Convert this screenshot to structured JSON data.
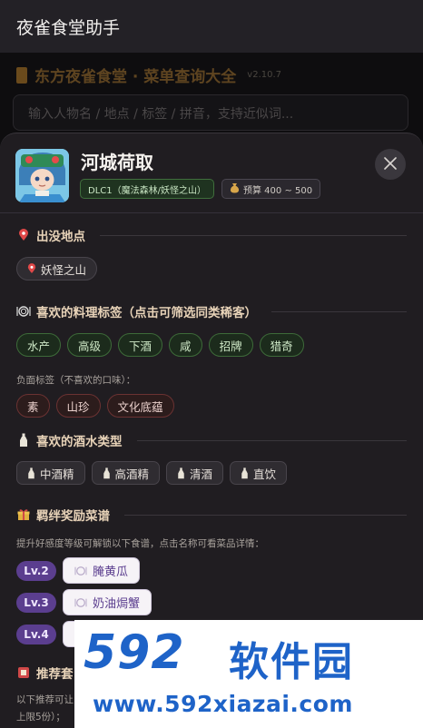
{
  "app": {
    "title": "夜雀食堂助手"
  },
  "behind": {
    "header_title": "东方夜雀食堂 · 菜单查询大全",
    "version": "v2.10.7",
    "search_placeholder": "输入人物名 / 地点 / 标签 / 拼音，支持近似词..."
  },
  "character": {
    "name": "河城荷取",
    "dlc": "DLC1（魔法森林/妖怪之山）",
    "budget": "预算 400 ~ 500"
  },
  "sections": {
    "location": {
      "title": "出没地点",
      "items": [
        "妖怪之山"
      ]
    },
    "likes": {
      "title": "喜欢的料理标签（点击可筛选同类稀客）",
      "positive": [
        "水产",
        "高级",
        "下酒",
        "咸",
        "招牌",
        "猎奇"
      ],
      "negative_label": "负面标签（不喜欢的口味）：",
      "negative": [
        "素",
        "山珍",
        "文化底蕴"
      ]
    },
    "drinks": {
      "title": "喜欢的酒水类型",
      "items": [
        "中酒精",
        "高酒精",
        "清酒",
        "直饮"
      ]
    },
    "rewards": {
      "title": "羁绊奖励菜谱",
      "desc": "提升好感度等级可解锁以下食谱，点击名称可看菜品详情：",
      "items": [
        {
          "level": "Lv.2",
          "dish": "腌黄瓜"
        },
        {
          "level": "Lv.3",
          "dish": "奶油焗蟹"
        },
        {
          "level": "Lv.4",
          "dish": ""
        }
      ]
    },
    "recommend": {
      "title": "推荐套",
      "desc1": "以下推荐可让",
      "desc2": "上限5份）；"
    }
  },
  "watermark": {
    "digits": "592",
    "text": "软件园",
    "url": "www.592xiazai.com"
  },
  "colors": {
    "accent_purple": "#5b3e8f",
    "good_green": "#3d6a39",
    "bad_red": "#6b3232",
    "watermark_blue": "#1e63c8"
  }
}
